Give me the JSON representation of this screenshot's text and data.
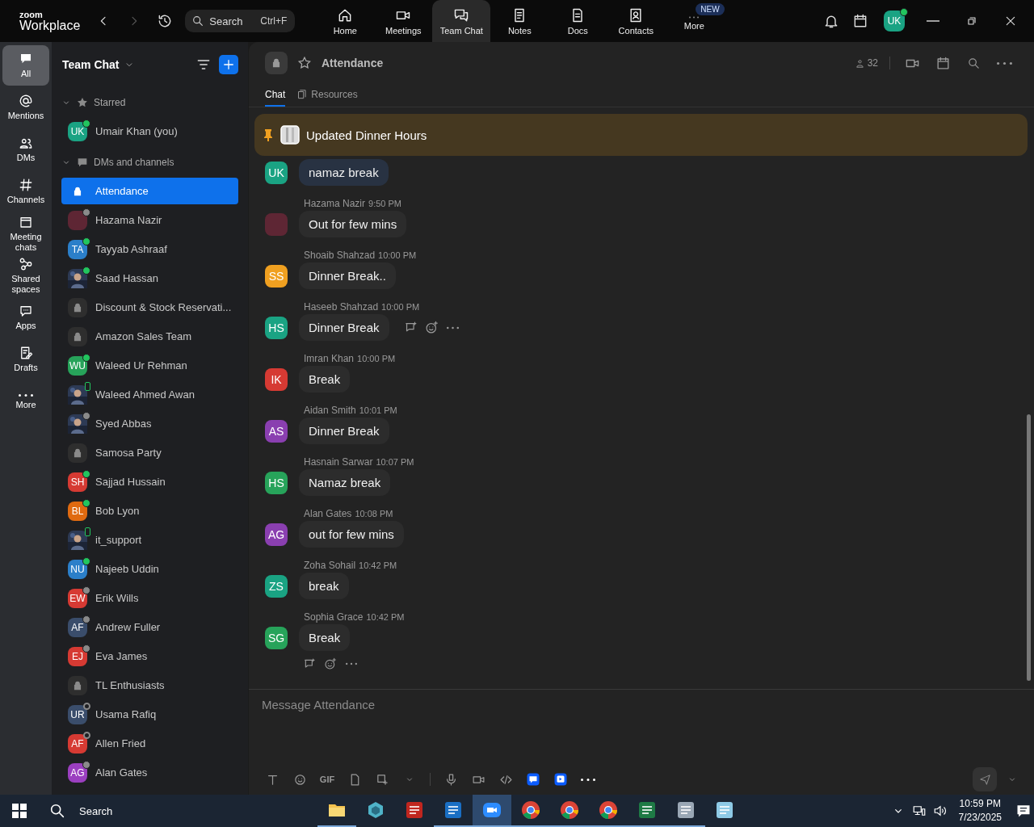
{
  "app": {
    "logo_small": "zoom",
    "logo_large": "Workplace"
  },
  "search": {
    "placeholder": "Search",
    "shortcut": "Ctrl+F"
  },
  "nav_tabs": [
    {
      "kind": "home",
      "label": "Home",
      "selected": false
    },
    {
      "kind": "meetings",
      "label": "Meetings",
      "selected": false
    },
    {
      "kind": "chat",
      "label": "Team Chat",
      "selected": true
    },
    {
      "kind": "notes",
      "label": "Notes",
      "selected": false
    },
    {
      "kind": "docs",
      "label": "Docs",
      "selected": false
    },
    {
      "kind": "contacts",
      "label": "Contacts",
      "selected": false
    },
    {
      "kind": "more",
      "label": "More",
      "selected": false,
      "badge": "NEW"
    }
  ],
  "user": {
    "initials": "UK",
    "color": "#1aa383",
    "presence": {
      "kind": "online"
    }
  },
  "rail": [
    {
      "kind": "all",
      "label": "All",
      "selected": true
    },
    {
      "kind": "mentions",
      "label": "Mentions",
      "selected": false
    },
    {
      "kind": "dms",
      "label": "DMs",
      "selected": false
    },
    {
      "kind": "channels",
      "label": "Channels",
      "selected": false
    },
    {
      "kind": "meeting",
      "label": "Meeting chats",
      "selected": false
    },
    {
      "kind": "shared",
      "label": "Shared spaces",
      "selected": false
    },
    {
      "kind": "apps",
      "label": "Apps",
      "selected": false
    },
    {
      "kind": "drafts",
      "label": "Drafts",
      "selected": false
    },
    {
      "kind": "more",
      "label": "More",
      "selected": false
    }
  ],
  "sidebar": {
    "title": "Team Chat",
    "sections": [
      {
        "kind": "starred",
        "label": "Starred",
        "expanded": true,
        "items": [
          {
            "name": "Umair Khan (you)",
            "avatar": {
              "kind": "initials",
              "initials": "UK",
              "color": "#1aa383"
            },
            "presence": {
              "kind": "online"
            },
            "selected": false
          }
        ]
      },
      {
        "kind": "dms",
        "label": "DMs and channels",
        "expanded": true,
        "items": [
          {
            "name": "Attendance",
            "avatar": {
              "kind": "lock"
            },
            "selected": true
          },
          {
            "name": "Hazama Nazir",
            "avatar": {
              "kind": "blank",
              "color": "#5e2634"
            },
            "presence": {
              "kind": "away"
            },
            "selected": false
          },
          {
            "name": "Tayyab Ashraaf",
            "avatar": {
              "kind": "initials",
              "initials": "TA",
              "color": "#2b7fc9"
            },
            "presence": {
              "kind": "online"
            },
            "selected": false
          },
          {
            "name": "Saad Hassan",
            "presence": {
              "kind": "online"
            },
            "selected": false
          },
          {
            "name": "Discount & Stock Reservati...",
            "avatar": {
              "kind": "lock"
            },
            "selected": false
          },
          {
            "name": "Amazon Sales Team",
            "avatar": {
              "kind": "lock"
            },
            "selected": false
          },
          {
            "name": "Waleed Ur Rehman",
            "avatar": {
              "kind": "initials",
              "initials": "WU",
              "color": "#27a35a"
            },
            "presence": {
              "kind": "online"
            },
            "selected": false
          },
          {
            "name": "Waleed Ahmed Awan",
            "presence": {
              "kind": "mobile"
            },
            "selected": false
          },
          {
            "name": "Syed Abbas",
            "presence": {
              "kind": "away"
            },
            "selected": false
          },
          {
            "name": "Samosa Party",
            "avatar": {
              "kind": "lock"
            },
            "selected": false
          },
          {
            "name": "Sajjad Hussain",
            "avatar": {
              "kind": "initials",
              "initials": "SH",
              "color": "#d63a33"
            },
            "presence": {
              "kind": "online"
            },
            "selected": false
          },
          {
            "name": "Bob Lyon",
            "avatar": {
              "kind": "initials",
              "initials": "BL",
              "color": "#e06a10"
            },
            "presence": {
              "kind": "online"
            },
            "selected": false
          },
          {
            "name": "it_support",
            "presence": {
              "kind": "mobile"
            },
            "selected": false
          },
          {
            "name": "Najeeb Uddin",
            "avatar": {
              "kind": "initials",
              "initials": "NU",
              "color": "#2b7fc9"
            },
            "presence": {
              "kind": "online"
            },
            "selected": false
          },
          {
            "name": "Erik Wills",
            "avatar": {
              "kind": "initials",
              "initials": "EW",
              "color": "#d63a33"
            },
            "presence": {
              "kind": "away"
            },
            "selected": false
          },
          {
            "name": "Andrew Fuller",
            "avatar": {
              "kind": "initials",
              "initials": "AF",
              "color": "#3a4d6b"
            },
            "presence": {
              "kind": "away"
            },
            "selected": false
          },
          {
            "name": "Eva James",
            "avatar": {
              "kind": "initials",
              "initials": "EJ",
              "color": "#d63a33"
            },
            "presence": {
              "kind": "away"
            },
            "selected": false
          },
          {
            "name": "TL Enthusiasts",
            "avatar": {
              "kind": "lock"
            },
            "selected": false
          },
          {
            "name": "Usama Rafiq",
            "avatar": {
              "kind": "initials",
              "initials": "UR",
              "color": "#3a4d6b"
            },
            "presence": {
              "kind": "offline"
            },
            "selected": false
          },
          {
            "name": "Allen Fried",
            "avatar": {
              "kind": "initials",
              "initials": "AF",
              "color": "#d63a33"
            },
            "presence": {
              "kind": "offline"
            },
            "selected": false
          },
          {
            "name": "Alan Gates",
            "avatar": {
              "kind": "initials",
              "initials": "AG",
              "color": "#9b3fc0"
            },
            "presence": {
              "kind": "away"
            },
            "selected": false
          }
        ]
      }
    ]
  },
  "channel": {
    "name": "Attendance",
    "starred": false,
    "members": "32",
    "tabs": [
      {
        "kind": "chat",
        "label": "Chat",
        "selected": true
      },
      {
        "kind": "resources",
        "label": "Resources",
        "selected": false
      }
    ]
  },
  "pinned": {
    "text": "Updated Dinner Hours"
  },
  "messages": [
    {
      "avatar": {
        "kind": "initials",
        "initials": "UK",
        "color": "#1aa383"
      },
      "text": "namaz break",
      "own": true
    },
    {
      "sender": "Hazama Nazir",
      "time": "9:50 PM",
      "avatar": {
        "kind": "blank",
        "color": "#5e2634"
      },
      "text": "Out for few mins",
      "own": false
    },
    {
      "sender": "Shoaib Shahzad",
      "time": "10:00 PM",
      "avatar": {
        "kind": "initials",
        "initials": "SS",
        "color": "#f0a020"
      },
      "text": "Dinner Break..",
      "own": false
    },
    {
      "sender": "Haseeb Shahzad",
      "time": "10:00 PM",
      "avatar": {
        "kind": "initials",
        "initials": "HS",
        "color": "#1aa383"
      },
      "text": "Dinner Break",
      "own": false,
      "actions": {
        "kind": "inline"
      }
    },
    {
      "sender": "Imran Khan",
      "time": "10:00 PM",
      "avatar": {
        "kind": "initials",
        "initials": "IK",
        "color": "#d63a33"
      },
      "text": "Break",
      "own": false
    },
    {
      "sender": "Aidan Smith",
      "time": "10:01 PM",
      "avatar": {
        "kind": "initials",
        "initials": "AS",
        "color": "#8a3fb0"
      },
      "text": "Dinner Break",
      "own": false
    },
    {
      "sender": "Hasnain Sarwar",
      "time": "10:07 PM",
      "avatar": {
        "kind": "initials",
        "initials": "HS",
        "color": "#27a35a"
      },
      "text": "Namaz break",
      "own": false
    },
    {
      "sender": "Alan Gates",
      "time": "10:08 PM",
      "avatar": {
        "kind": "initials",
        "initials": "AG",
        "color": "#8a3fb0"
      },
      "text": "out for few mins",
      "own": false
    },
    {
      "sender": "Zoha Sohail",
      "time": "10:42 PM",
      "avatar": {
        "kind": "initials",
        "initials": "ZS",
        "color": "#1aa383"
      },
      "text": "break",
      "own": false
    },
    {
      "sender": "Sophia Grace",
      "time": "10:42 PM",
      "avatar": {
        "kind": "initials",
        "initials": "SG",
        "color": "#27a35a"
      },
      "text": "Break",
      "own": false,
      "actions": {
        "kind": "below"
      }
    }
  ],
  "composer": {
    "placeholder": "Message Attendance",
    "gif_label": "GIF"
  },
  "taskbar": {
    "search_placeholder": "Search",
    "time": "10:59 PM",
    "date": "7/23/2025",
    "apps": [
      {
        "kind": "explorer",
        "running": true,
        "selected": false
      },
      {
        "kind": "gem",
        "running": false,
        "selected": false
      },
      {
        "kind": "filezilla",
        "running": false,
        "selected": false
      },
      {
        "kind": "outlook",
        "running": true,
        "selected": false
      },
      {
        "kind": "zoom",
        "running": true,
        "selected": true
      },
      {
        "kind": "chrome",
        "running": true,
        "selected": false
      },
      {
        "kind": "chrome",
        "running": true,
        "selected": false
      },
      {
        "kind": "chrome",
        "running": true,
        "selected": false
      },
      {
        "kind": "excel",
        "running": true,
        "selected": false
      },
      {
        "kind": "calculator",
        "running": true,
        "selected": false
      },
      {
        "kind": "notepad",
        "running": false,
        "selected": false
      }
    ]
  }
}
